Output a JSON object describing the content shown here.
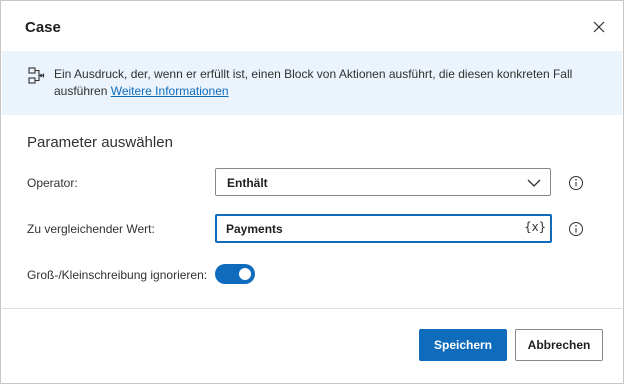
{
  "dialog": {
    "title": "Case",
    "close_icon": "close-icon"
  },
  "banner": {
    "icon": "case-block-icon",
    "text": "Ein Ausdruck, der, wenn er erfüllt ist, einen Block von Aktionen ausführt, die diesen konkreten Fall ausführen",
    "link": "Weitere Informationen",
    "background": "#ebf3fc"
  },
  "section": {
    "heading": "Parameter auswählen"
  },
  "fields": {
    "operator": {
      "label": "Operator:",
      "value": "Enthält",
      "icon": "chevron-down-icon",
      "info_icon": "info-icon"
    },
    "compare_value": {
      "label": "Zu vergleichender Wert:",
      "value": "Payments",
      "variable_icon": "{x}",
      "info_icon": "info-icon"
    },
    "ignore_case": {
      "label": "Groß-/Kleinschreibung ignorieren:",
      "enabled": true
    }
  },
  "buttons": {
    "save": "Speichern",
    "cancel": "Abbrechen"
  },
  "colors": {
    "accent": "#0f6cbd",
    "border": "#8a8886"
  }
}
